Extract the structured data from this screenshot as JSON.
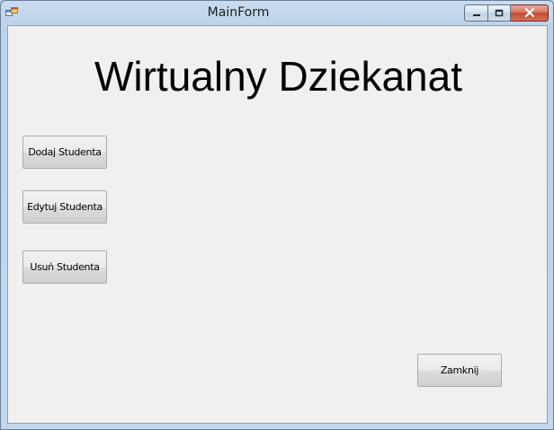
{
  "window": {
    "title": "MainForm"
  },
  "main": {
    "heading": "Wirtualny Dziekanat",
    "buttons": {
      "add_student": "Dodaj Studenta",
      "edit_student": "Edytuj Studenta",
      "delete_student": "Usuń Studenta",
      "close": "Zamknij"
    }
  },
  "icons": {
    "app": "app-form-icon",
    "minimize": "minimize-icon",
    "maximize": "maximize-icon",
    "close": "close-icon"
  }
}
